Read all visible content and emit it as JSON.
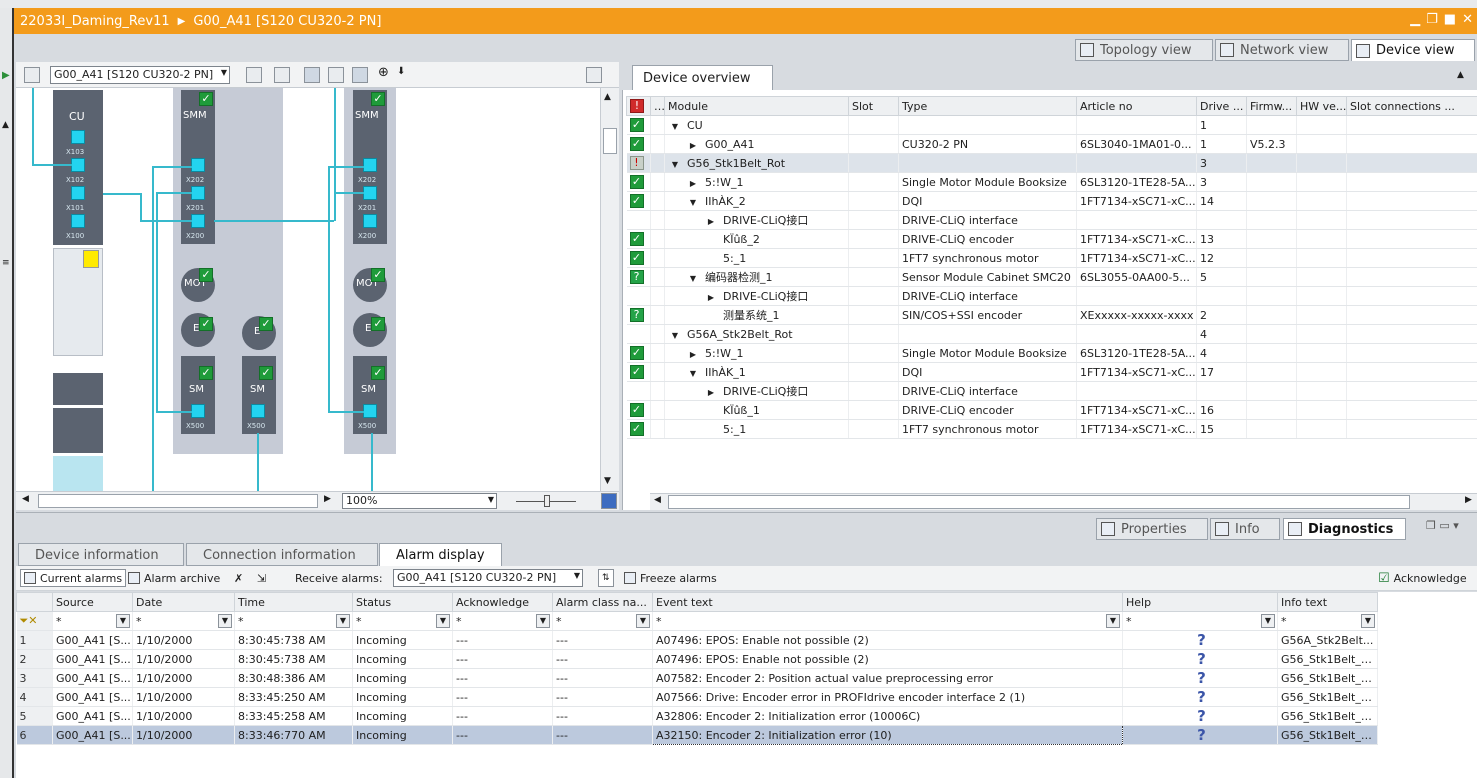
{
  "title": {
    "project": "22033I_Daming_Rev11",
    "device": "G00_A41 [S120 CU320-2 PN]"
  },
  "view_tabs": [
    "Topology view",
    "Network view",
    "Device view"
  ],
  "canvas": {
    "module_select": "G00_A41 [S120 CU320-2 PN]",
    "zoom": "100%",
    "modules": {
      "cu": "CU",
      "smm1": "SMM",
      "smm2": "SMM",
      "mot1": "MOT",
      "mot2": "MOT",
      "e1": "E",
      "e2": "E",
      "e3": "E",
      "sm1": "SM",
      "sm2": "SM",
      "sm3": "SM"
    },
    "ports": {
      "x103": "X103",
      "x102": "X102",
      "x101": "X101",
      "x100": "X100",
      "x202a": "X202",
      "x201a": "X201",
      "x200a": "X200",
      "x202b": "X202",
      "x201b": "X201",
      "x200b": "X200",
      "x500a": "X500",
      "x500b": "X500",
      "x500c": "X500"
    }
  },
  "overview": {
    "tab": "Device overview",
    "columns": [
      "Module",
      "Slot",
      "Type",
      "Article no",
      "Drive ...",
      "Firmw...",
      "HW ve...",
      "Slot connections ..."
    ],
    "rows": [
      {
        "indent": 0,
        "expander": "open",
        "module": "CU",
        "type": "",
        "article": "",
        "drive": "1",
        "firmware": "",
        "status": "ok"
      },
      {
        "indent": 1,
        "expander": "closed",
        "module": "G00_A41",
        "type": "CU320-2 PN",
        "article": "6SL3040-1MA01-0...",
        "drive": "1",
        "firmware": "V5.2.3",
        "status": "ok"
      },
      {
        "indent": 0,
        "expander": "open",
        "module": "G56_Stk1Belt_Rot",
        "type": "",
        "article": "",
        "drive": "3",
        "firmware": "",
        "status": "error"
      },
      {
        "indent": 1,
        "expander": "closed",
        "module": "5:!W_1",
        "type": "Single Motor Module Booksize",
        "article": "6SL3120-1TE28-5A...",
        "drive": "3",
        "firmware": "",
        "status": "ok"
      },
      {
        "indent": 1,
        "expander": "open",
        "module": "IIhÀK_2",
        "type": "DQI",
        "article": "1FT7134-xSC71-xC...",
        "drive": "14",
        "firmware": "",
        "status": "ok"
      },
      {
        "indent": 2,
        "expander": "closed",
        "module": "DRIVE-CLiQ接口",
        "type": "DRIVE-CLiQ interface",
        "article": "",
        "drive": "",
        "firmware": "",
        "status": "none"
      },
      {
        "indent": 2,
        "expander": "",
        "module": "KÏûß_2",
        "type": "DRIVE-CLiQ encoder",
        "article": "1FT7134-xSC71-xC...",
        "drive": "13",
        "firmware": "",
        "status": "ok"
      },
      {
        "indent": 2,
        "expander": "",
        "module": "5:_1",
        "type": "1FT7 synchronous motor",
        "article": "1FT7134-xSC71-xC...",
        "drive": "12",
        "firmware": "",
        "status": "ok"
      },
      {
        "indent": 1,
        "expander": "open",
        "module": "编码器检测_1",
        "type": "Sensor Module Cabinet SMC20",
        "article": "6SL3055-0AA00-5...",
        "drive": "5",
        "firmware": "",
        "status": "warn"
      },
      {
        "indent": 2,
        "expander": "closed",
        "module": "DRIVE-CLiQ接口",
        "type": "DRIVE-CLiQ interface",
        "article": "",
        "drive": "",
        "firmware": "",
        "status": "none"
      },
      {
        "indent": 2,
        "expander": "",
        "module": "测量系统_1",
        "type": "SIN/COS+SSI encoder",
        "article": "XExxxxx-xxxxx-xxxx",
        "drive": "2",
        "firmware": "",
        "status": "warn"
      },
      {
        "indent": 0,
        "expander": "open",
        "module": "G56A_Stk2Belt_Rot",
        "type": "",
        "article": "",
        "drive": "4",
        "firmware": "",
        "status": "none"
      },
      {
        "indent": 1,
        "expander": "closed",
        "module": "5:!W_1",
        "type": "Single Motor Module Booksize",
        "article": "6SL3120-1TE28-5A...",
        "drive": "4",
        "firmware": "",
        "status": "ok"
      },
      {
        "indent": 1,
        "expander": "open",
        "module": "IIhÀK_1",
        "type": "DQI",
        "article": "1FT7134-xSC71-xC...",
        "drive": "17",
        "firmware": "",
        "status": "ok"
      },
      {
        "indent": 2,
        "expander": "closed",
        "module": "DRIVE-CLiQ接口",
        "type": "DRIVE-CLiQ interface",
        "article": "",
        "drive": "",
        "firmware": "",
        "status": "none"
      },
      {
        "indent": 2,
        "expander": "",
        "module": "KÏûß_1",
        "type": "DRIVE-CLiQ encoder",
        "article": "1FT7134-xSC71-xC...",
        "drive": "16",
        "firmware": "",
        "status": "ok"
      },
      {
        "indent": 2,
        "expander": "",
        "module": "5:_1",
        "type": "1FT7 synchronous motor",
        "article": "1FT7134-xSC71-xC...",
        "drive": "15",
        "firmware": "",
        "status": "ok"
      }
    ]
  },
  "inspector": {
    "tabs": [
      "Properties",
      "Info",
      "Diagnostics"
    ],
    "sub_tabs": [
      "Device information",
      "Connection information",
      "Alarm display"
    ],
    "toolbar": {
      "current_alarms": "Current alarms",
      "alarm_archive": "Alarm archive",
      "receive_label": "Receive alarms:",
      "receive_value": "G00_A41 [S120 CU320-2 PN]",
      "freeze": "Freeze alarms",
      "acknowledge": "Acknowledge"
    },
    "alarm_columns": [
      "Source",
      "Date",
      "Time",
      "Status",
      "Acknowledge",
      "Alarm class na...",
      "Event text",
      "Help",
      "Info text"
    ],
    "filter_value": "*",
    "alarms": [
      {
        "n": "1",
        "source": "G00_A41 [S...",
        "date": "1/10/2000",
        "time": "8:30:45:738 AM",
        "status": "Incoming",
        "ack": "---",
        "cls": "---",
        "event": "A07496: EPOS: Enable not possible (2)",
        "info": "G56A_Stk2Belt..."
      },
      {
        "n": "2",
        "source": "G00_A41 [S...",
        "date": "1/10/2000",
        "time": "8:30:45:738 AM",
        "status": "Incoming",
        "ack": "---",
        "cls": "---",
        "event": "A07496: EPOS: Enable not possible (2)",
        "info": "G56_Stk1Belt_R..."
      },
      {
        "n": "3",
        "source": "G00_A41 [S...",
        "date": "1/10/2000",
        "time": "8:30:48:386 AM",
        "status": "Incoming",
        "ack": "---",
        "cls": "---",
        "event": "A07582: Encoder 2: Position actual value preprocessing error",
        "info": "G56_Stk1Belt_R..."
      },
      {
        "n": "4",
        "source": "G00_A41 [S...",
        "date": "1/10/2000",
        "time": "8:33:45:250 AM",
        "status": "Incoming",
        "ack": "---",
        "cls": "---",
        "event": "A07566: Drive: Encoder error in PROFIdrive encoder interface 2 (1)",
        "info": "G56_Stk1Belt_R..."
      },
      {
        "n": "5",
        "source": "G00_A41 [S...",
        "date": "1/10/2000",
        "time": "8:33:45:258 AM",
        "status": "Incoming",
        "ack": "---",
        "cls": "---",
        "event": "A32806: Encoder 2: Initialization error (10006C)",
        "info": "G56_Stk1Belt_R..."
      },
      {
        "n": "6",
        "source": "G00_A41 [S...",
        "date": "1/10/2000",
        "time": "8:33:46:770 AM",
        "status": "Incoming",
        "ack": "---",
        "cls": "---",
        "event": "A32150: Encoder 2: Initialization error (10)",
        "info": "G56_Stk1Belt_R..."
      }
    ]
  }
}
